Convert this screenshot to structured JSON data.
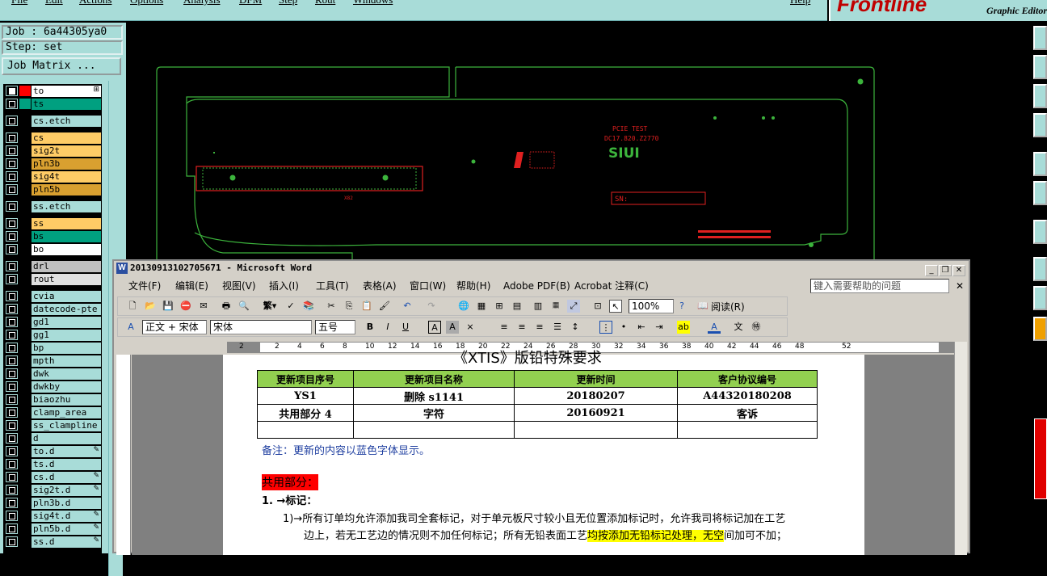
{
  "app": {
    "menu": [
      "File",
      "Edit",
      "Actions",
      "Options",
      "Analysis",
      "DFM",
      "Step",
      "Rout",
      "Windows"
    ],
    "help": "Help",
    "logo": "Frontline",
    "logo_sub": "Graphic Editor"
  },
  "info": {
    "job": "Job : 6a44305ya0",
    "step": "Step: set",
    "job_matrix": "Job Matrix ..."
  },
  "layers": [
    {
      "name": "to",
      "color": "#ffffff",
      "sw": "#ff0000",
      "mark": "⊞",
      "sel": true
    },
    {
      "name": "ts",
      "color": "#00a080",
      "sw": "#00a080"
    },
    {
      "name": "cs.etch",
      "color": "#a8dcd8"
    },
    {
      "name": "cs",
      "color": "#ffcc66"
    },
    {
      "name": "sig2t",
      "color": "#ffcc66"
    },
    {
      "name": "pln3b",
      "color": "#d9a030"
    },
    {
      "name": "sig4t",
      "color": "#ffcc66"
    },
    {
      "name": "pln5b",
      "color": "#d9a030"
    },
    {
      "name": "ss.etch",
      "color": "#a8dcd8"
    },
    {
      "name": "ss",
      "color": "#ffcc66"
    },
    {
      "name": "bs",
      "color": "#00a080"
    },
    {
      "name": "bo",
      "color": "#ffffff"
    },
    {
      "name": "drl",
      "color": "#c0c0c0"
    },
    {
      "name": "rout",
      "color": "#e0e0e0"
    },
    {
      "name": "cvia",
      "color": "#a8dcd8"
    },
    {
      "name": "datecode-pte",
      "color": "#a8dcd8"
    },
    {
      "name": "gd1",
      "color": "#a8dcd8"
    },
    {
      "name": "gg1",
      "color": "#a8dcd8"
    },
    {
      "name": "bp",
      "color": "#a8dcd8"
    },
    {
      "name": "mpth",
      "color": "#a8dcd8"
    },
    {
      "name": "dwk",
      "color": "#a8dcd8"
    },
    {
      "name": "dwkby",
      "color": "#a8dcd8"
    },
    {
      "name": "biaozhu",
      "color": "#a8dcd8"
    },
    {
      "name": "clamp_area",
      "color": "#a8dcd8"
    },
    {
      "name": "ss_clampline",
      "color": "#a8dcd8"
    },
    {
      "name": "d",
      "color": "#a8dcd8"
    },
    {
      "name": "to.d",
      "color": "#a8dcd8",
      "mark": "✎"
    },
    {
      "name": "ts.d",
      "color": "#a8dcd8"
    },
    {
      "name": "cs.d",
      "color": "#a8dcd8",
      "mark": "✎"
    },
    {
      "name": "sig2t.d",
      "color": "#a8dcd8",
      "mark": "✎"
    },
    {
      "name": "pln3b.d",
      "color": "#a8dcd8"
    },
    {
      "name": "sig4t.d",
      "color": "#a8dcd8",
      "mark": "✎"
    },
    {
      "name": "pln5b.d",
      "color": "#a8dcd8",
      "mark": "✎"
    },
    {
      "name": "ss.d",
      "color": "#a8dcd8",
      "mark": "✎"
    }
  ],
  "board": {
    "pcie": "PCIE TEST",
    "code": "DC17.820.Z2770",
    "logo": "SIUI",
    "sn": "SN:",
    "x82": "X82"
  },
  "word": {
    "title": "20130913102705671 - Microsoft Word",
    "menu": [
      "文件(F)",
      "编辑(E)",
      "视图(V)",
      "插入(I)",
      "工具(T)",
      "表格(A)",
      "窗口(W)",
      "帮助(H)",
      "Adobe PDF(B)",
      "Acrobat 注释(C)"
    ],
    "help_box": "键入需要帮助的问题",
    "zoom": "100%",
    "read": "阅读(R)",
    "style": "正文 + 宋体",
    "font": "宋体",
    "size": "五号",
    "heading_partial": "《XTIS》版铅特殊要求",
    "table": {
      "headers": [
        "更新项目序号",
        "更新项目名称",
        "更新时间",
        "客户协议编号"
      ],
      "rows": [
        [
          "YS1",
          "删除 s1141",
          "20180207",
          "A44320180208"
        ],
        [
          "共用部分 4",
          "字符",
          "20160921",
          "客诉"
        ],
        [
          "",
          "",
          "",
          ""
        ]
      ]
    },
    "note": "备注：更新的内容以蓝色字体显示。",
    "section": "共用部分：",
    "item": "1. →标记：",
    "para1": "1)→所有订单均允许添加我司全套标记，对于单元板尺寸较小且无位置添加标记时，允许我司将标记加在工艺",
    "para2a": "边上，若无工艺边的情况则不加任何标记；所有无铅表面工艺",
    "para2b": "均按添加无铅标记处理，无空",
    "para2c": "间加可不加；",
    "ruler": [
      "2",
      "2",
      "4",
      "6",
      "8",
      "10",
      "12",
      "14",
      "16",
      "18",
      "20",
      "22",
      "24",
      "26",
      "28",
      "30",
      "32",
      "34",
      "36",
      "38",
      "40",
      "42",
      "44",
      "46",
      "48",
      "52"
    ]
  }
}
